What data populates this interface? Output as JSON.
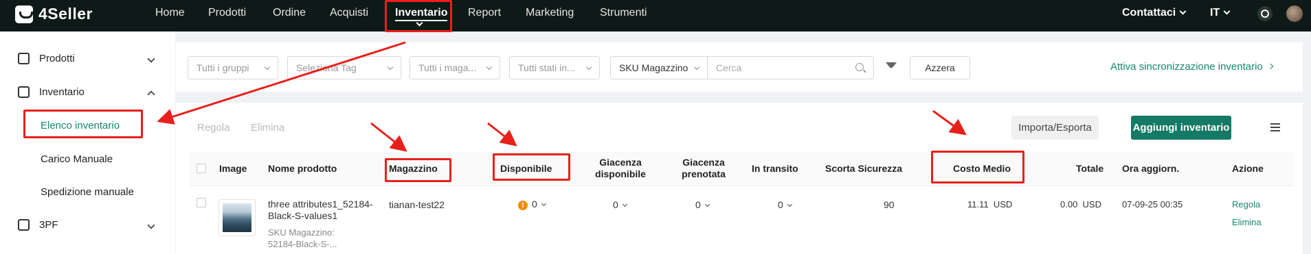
{
  "topbar": {
    "brand": "4Seller",
    "nav": [
      "Home",
      "Prodotti",
      "Ordine",
      "Acquisti",
      "Inventario",
      "Report",
      "Marketing",
      "Strumenti"
    ],
    "active": "Inventario",
    "contact": "Contattaci",
    "lang": "IT"
  },
  "sidebar": {
    "items": [
      {
        "label": "Prodotti",
        "icon": "box-icon",
        "expanded": false
      },
      {
        "label": "Inventario",
        "icon": "warehouse-icon",
        "expanded": true
      },
      {
        "label": "3PF",
        "icon": "warehouse-icon",
        "expanded": false
      }
    ],
    "sub": [
      "Elenco inventario",
      "Carico Manuale",
      "Spedizione manuale"
    ],
    "active_sub": "Elenco inventario"
  },
  "filters": {
    "groups": "Tutti i gruppi",
    "tag": "Seleziona Tag",
    "warehouse": "Tutti i maga...",
    "status": "Tutti stati in...",
    "sku_type": "SKU Magazzino",
    "search_placeholder": "Cerca",
    "reset": "Azzera",
    "sync": "Attiva sincronizzazione inventario"
  },
  "toolbar": {
    "regola": "Regola",
    "elimina": "Elimina",
    "import_export": "Importa/Esporta",
    "add": "Aggiungi inventario"
  },
  "table": {
    "headers": {
      "image": "Image",
      "name": "Nome prodotto",
      "warehouse": "Magazzino",
      "available": "Disponibile",
      "avail_stock_1": "Giacenza",
      "avail_stock_2": "disponibile",
      "reserved_1": "Giacenza",
      "reserved_2": "prenotata",
      "transit": "In transito",
      "safety": "Scorta Sicurezza",
      "avg_cost": "Costo Medio",
      "total": "Totale",
      "updated": "Ora aggiorn.",
      "action": "Azione"
    },
    "row": {
      "name_1": "three attributes1_52184-",
      "name_2": "Black-S-values1",
      "sku_label": "SKU Magazzino:",
      "sku_value": "52184-Black-S-...",
      "warehouse": "tianan-test22",
      "available": "0",
      "avail_stock": "0",
      "reserved": "0",
      "transit": "0",
      "safety": "90",
      "avg_cost": "11.11",
      "avg_cost_cur": "USD",
      "total": "0.00",
      "total_cur": "USD",
      "updated": "07-09-25 00:35",
      "action_1": "Regola",
      "action_2": "Elimina"
    }
  },
  "colors": {
    "accent": "#147a66",
    "highlight": "#e8201b",
    "topbar": "#0e1a17"
  }
}
